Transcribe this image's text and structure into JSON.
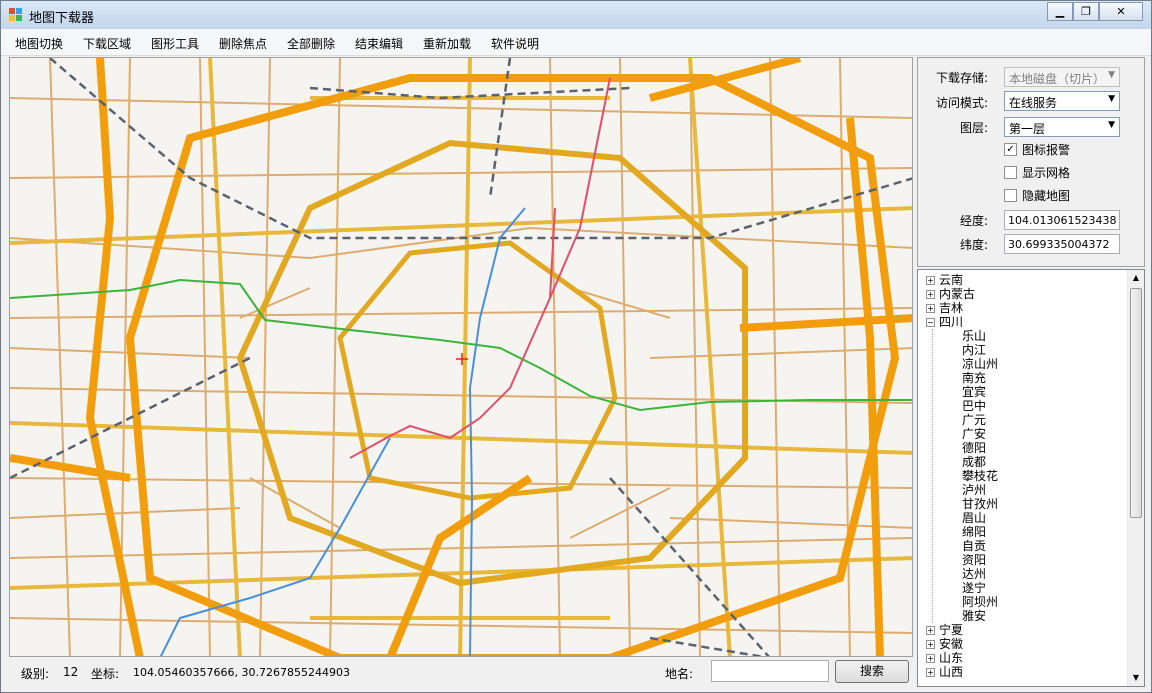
{
  "window": {
    "title": "地图下载器"
  },
  "menu": [
    "地图切换",
    "下载区域",
    "图形工具",
    "删除焦点",
    "全部删除",
    "结束编辑",
    "重新加载",
    "软件说明"
  ],
  "options": {
    "storage_label": "下载存储:",
    "storage_value": "本地磁盘（切片）",
    "access_label": "访问模式:",
    "access_value": "在线服务",
    "layer_label": "图层:",
    "layer_value": "第一层",
    "checkboxes": [
      {
        "label": "图标报警",
        "checked": true
      },
      {
        "label": "显示网格",
        "checked": false
      },
      {
        "label": "隐藏地图",
        "checked": false
      }
    ],
    "lng_label": "经度:",
    "lng_value": "104.013061523438",
    "lat_label": "纬度:",
    "lat_value": "30.699335004372"
  },
  "tree": {
    "before": [
      "云南",
      "内蒙古",
      "吉林"
    ],
    "expanded": "四川",
    "children": [
      "乐山",
      "内江",
      "凉山州",
      "南充",
      "宜宾",
      "巴中",
      "广元",
      "广安",
      "德阳",
      "成都",
      "攀枝花",
      "泸州",
      "甘孜州",
      "眉山",
      "绵阳",
      "自贡",
      "资阳",
      "达州",
      "遂宁",
      "阿坝州",
      "雅安"
    ],
    "after": [
      "宁夏",
      "安徽",
      "山东",
      "山西"
    ]
  },
  "status": {
    "level_label": "级别:",
    "level_value": "12",
    "coord_label": "坐标:",
    "coord_value": "104.05460357666, 30.7267855244903",
    "place_label": "地名:",
    "search_label": "搜索"
  },
  "colors": {
    "highway": "#f29e0c",
    "major_road": "#e7b83c",
    "minor_road": "#d9a05a",
    "railway": "#5a6270",
    "metro_green": "#3cb43c",
    "metro_blue": "#4a90d9",
    "metro_pink": "#e0506a"
  }
}
